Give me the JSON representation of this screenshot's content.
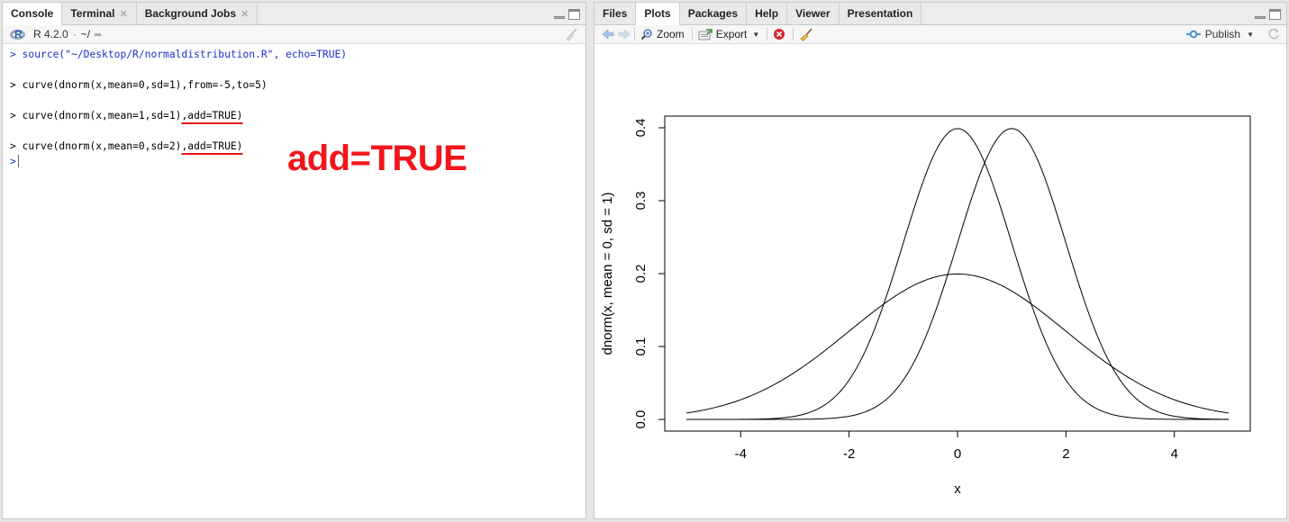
{
  "left_pane": {
    "tabs": [
      {
        "label": "Console",
        "closable": false
      },
      {
        "label": "Terminal",
        "closable": true
      },
      {
        "label": "Background Jobs",
        "closable": true
      }
    ],
    "toolbar": {
      "r_version": "R 4.2.0",
      "separator": "·",
      "working_dir": "~/"
    },
    "console": {
      "prompt": ">",
      "lines": [
        {
          "text": "source(\"~/Desktop/R/normaldistribution.R\", echo=TRUE)"
        },
        {
          "text": "curve(dnorm(x,mean=0,sd=1),from=-5,to=5)"
        },
        {
          "text_before": "curve(dnorm(x,mean=1,sd=1)",
          "underlined": ",add=TRUE)"
        },
        {
          "text_before": "curve(dnorm(x,mean=0,sd=2)",
          "underlined": ",add=TRUE)"
        }
      ]
    },
    "annotation": {
      "text": "add=TRUE",
      "color": "#f2151c"
    }
  },
  "right_pane": {
    "tabs": [
      {
        "label": "Files"
      },
      {
        "label": "Plots",
        "active": true
      },
      {
        "label": "Packages"
      },
      {
        "label": "Help"
      },
      {
        "label": "Viewer"
      },
      {
        "label": "Presentation"
      }
    ],
    "toolbar": {
      "zoom": "Zoom",
      "export": "Export",
      "publish": "Publish"
    }
  },
  "chart_data": {
    "type": "line",
    "title": "",
    "xlabel": "x",
    "ylabel": "dnorm(x, mean = 0, sd = 1)",
    "xlim": [
      -5,
      5
    ],
    "ylim": [
      0,
      0.4
    ],
    "xticks": [
      "-4",
      "-2",
      "0",
      "2",
      "4"
    ],
    "xtick_values": [
      -4,
      -2,
      0,
      2,
      4
    ],
    "yticks": [
      "0.0",
      "0.1",
      "0.2",
      "0.3",
      "0.4"
    ],
    "ytick_values": [
      0,
      0.1,
      0.2,
      0.3,
      0.4
    ],
    "series": [
      {
        "mean": 0,
        "sd": 1,
        "x_start": -5,
        "x_end": 5
      },
      {
        "mean": 1,
        "sd": 1,
        "x_start": -5,
        "x_end": 5
      },
      {
        "mean": 0,
        "sd": 2,
        "x_start": -5,
        "x_end": 5
      }
    ],
    "grid": false,
    "line_color": "#000000"
  }
}
